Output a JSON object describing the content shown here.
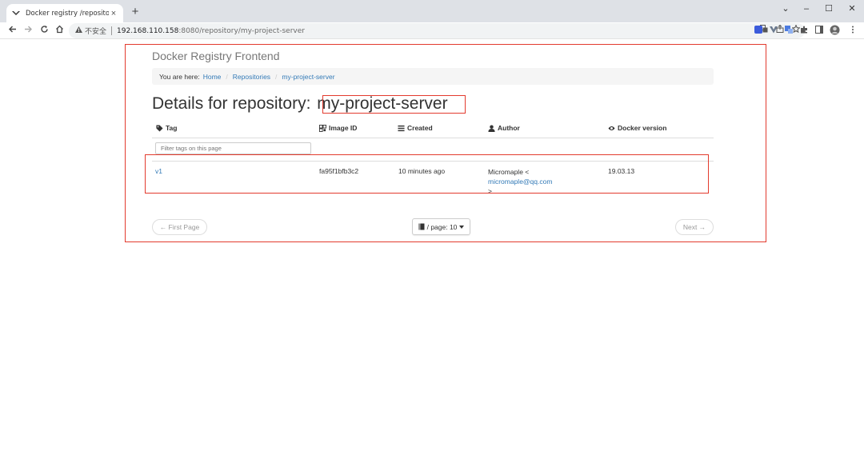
{
  "browser": {
    "tab_title": "Docker registry /repository/m",
    "tab_close": "×",
    "new_tab": "+",
    "address_warning": "不安全",
    "url_host": "192.168.110.158",
    "url_rest": ":8080/repository/my-project-server",
    "window_controls": [
      "⌄",
      "–",
      "☐",
      "✕"
    ]
  },
  "app": {
    "brand": "Docker Registry Frontend",
    "breadcrumb_label": "You are here:",
    "breadcrumb": [
      "Home",
      "Repositories",
      "my-project-server"
    ],
    "breadcrumb_divider": "/",
    "heading_prefix": "Details for repository:",
    "repository_name": "my-project-server"
  },
  "table": {
    "headers": {
      "tag": "Tag",
      "image_id": "Image ID",
      "created": "Created",
      "author": "Author",
      "docker_version": "Docker version"
    },
    "filter_placeholder": "Filter tags on this page",
    "rows": [
      {
        "tag": "v1",
        "image_id": "fa95f1bfb3c2",
        "created": "10 minutes ago",
        "author_name": "Micromaple <",
        "author_email": "micromaple@qq.com",
        "author_close": ">",
        "docker_version": "19.03.13"
      }
    ]
  },
  "pagination": {
    "first_page": "← First Page",
    "per_page_label": "/ page: 10",
    "next": "Next →"
  },
  "colors": {
    "highlight_border": "#e33b2e",
    "link": "#337ab7"
  }
}
